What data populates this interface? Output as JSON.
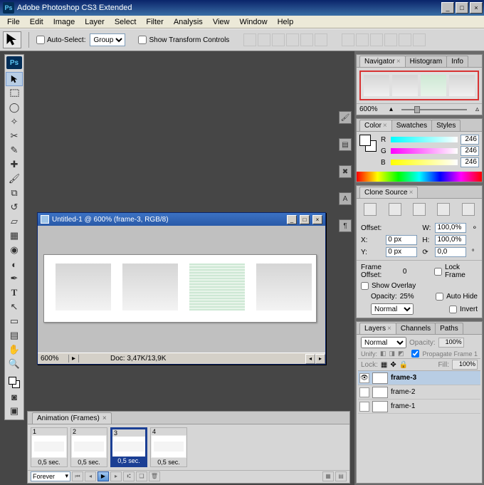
{
  "app": {
    "title": "Adobe Photoshop CS3 Extended",
    "badge": "Ps"
  },
  "menu": [
    "File",
    "Edit",
    "Image",
    "Layer",
    "Select",
    "Filter",
    "Analysis",
    "View",
    "Window",
    "Help"
  ],
  "options": {
    "auto_select": "Auto-Select:",
    "group": "Group",
    "show_transform": "Show Transform Controls"
  },
  "doc": {
    "title": "Untitled-1 @ 600% (frame-3, RGB/8)",
    "zoom": "600%",
    "status": "Doc: 3,47K/13,9K"
  },
  "animation": {
    "tab": "Animation (Frames)",
    "frames": [
      {
        "n": "1",
        "time": "0,5 sec."
      },
      {
        "n": "2",
        "time": "0,5 sec."
      },
      {
        "n": "3",
        "time": "0,5 sec."
      },
      {
        "n": "4",
        "time": "0,5 sec."
      }
    ],
    "loop": "Forever"
  },
  "navigator": {
    "tabs": [
      "Navigator",
      "Histogram",
      "Info"
    ],
    "zoom": "600%"
  },
  "color": {
    "tabs": [
      "Color",
      "Swatches",
      "Styles"
    ],
    "r": "246",
    "g": "246",
    "b": "246",
    "r_lbl": "R",
    "g_lbl": "G",
    "b_lbl": "B"
  },
  "clone": {
    "tab": "Clone Source",
    "offset_lbl": "Offset:",
    "x_lbl": "X:",
    "y_lbl": "Y:",
    "x": "0 px",
    "y": "0 px",
    "w_lbl": "W:",
    "h_lbl": "H:",
    "w": "100,0%",
    "h": "100,0%",
    "angle": "0,0",
    "frame_offset_lbl": "Frame Offset:",
    "frame_offset": "0",
    "lock_frame": "Lock Frame",
    "show_overlay": "Show Overlay",
    "opacity_lbl": "Opacity:",
    "opacity": "25%",
    "mode": "Normal",
    "auto_hide": "Auto Hide",
    "invert": "Invert"
  },
  "layers": {
    "tabs": [
      "Layers",
      "Channels",
      "Paths"
    ],
    "blend": "Normal",
    "opacity_lbl": "Opacity:",
    "opacity": "100%",
    "unify": "Unify:",
    "propagate": "Propagate Frame 1",
    "lock": "Lock:",
    "fill_lbl": "Fill:",
    "fill": "100%",
    "items": [
      {
        "name": "frame-3"
      },
      {
        "name": "frame-2"
      },
      {
        "name": "frame-1"
      }
    ]
  }
}
